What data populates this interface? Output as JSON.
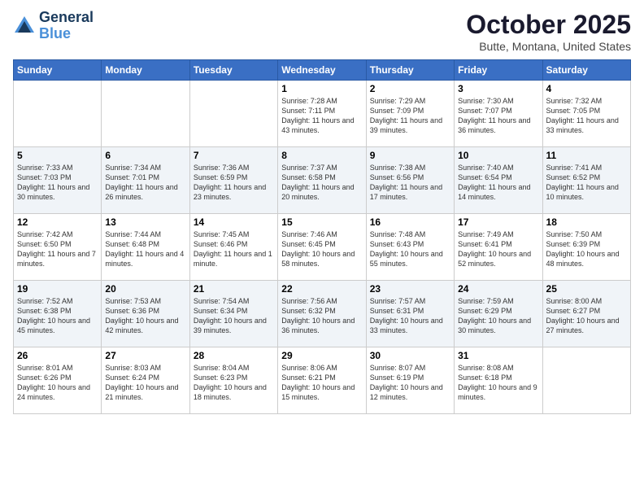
{
  "logo": {
    "line1": "General",
    "line2": "Blue"
  },
  "title": "October 2025",
  "location": "Butte, Montana, United States",
  "weekdays": [
    "Sunday",
    "Monday",
    "Tuesday",
    "Wednesday",
    "Thursday",
    "Friday",
    "Saturday"
  ],
  "weeks": [
    [
      {
        "day": "",
        "sunrise": "",
        "sunset": "",
        "daylight": ""
      },
      {
        "day": "",
        "sunrise": "",
        "sunset": "",
        "daylight": ""
      },
      {
        "day": "",
        "sunrise": "",
        "sunset": "",
        "daylight": ""
      },
      {
        "day": "1",
        "sunrise": "Sunrise: 7:28 AM",
        "sunset": "Sunset: 7:11 PM",
        "daylight": "Daylight: 11 hours and 43 minutes."
      },
      {
        "day": "2",
        "sunrise": "Sunrise: 7:29 AM",
        "sunset": "Sunset: 7:09 PM",
        "daylight": "Daylight: 11 hours and 39 minutes."
      },
      {
        "day": "3",
        "sunrise": "Sunrise: 7:30 AM",
        "sunset": "Sunset: 7:07 PM",
        "daylight": "Daylight: 11 hours and 36 minutes."
      },
      {
        "day": "4",
        "sunrise": "Sunrise: 7:32 AM",
        "sunset": "Sunset: 7:05 PM",
        "daylight": "Daylight: 11 hours and 33 minutes."
      }
    ],
    [
      {
        "day": "5",
        "sunrise": "Sunrise: 7:33 AM",
        "sunset": "Sunset: 7:03 PM",
        "daylight": "Daylight: 11 hours and 30 minutes."
      },
      {
        "day": "6",
        "sunrise": "Sunrise: 7:34 AM",
        "sunset": "Sunset: 7:01 PM",
        "daylight": "Daylight: 11 hours and 26 minutes."
      },
      {
        "day": "7",
        "sunrise": "Sunrise: 7:36 AM",
        "sunset": "Sunset: 6:59 PM",
        "daylight": "Daylight: 11 hours and 23 minutes."
      },
      {
        "day": "8",
        "sunrise": "Sunrise: 7:37 AM",
        "sunset": "Sunset: 6:58 PM",
        "daylight": "Daylight: 11 hours and 20 minutes."
      },
      {
        "day": "9",
        "sunrise": "Sunrise: 7:38 AM",
        "sunset": "Sunset: 6:56 PM",
        "daylight": "Daylight: 11 hours and 17 minutes."
      },
      {
        "day": "10",
        "sunrise": "Sunrise: 7:40 AM",
        "sunset": "Sunset: 6:54 PM",
        "daylight": "Daylight: 11 hours and 14 minutes."
      },
      {
        "day": "11",
        "sunrise": "Sunrise: 7:41 AM",
        "sunset": "Sunset: 6:52 PM",
        "daylight": "Daylight: 11 hours and 10 minutes."
      }
    ],
    [
      {
        "day": "12",
        "sunrise": "Sunrise: 7:42 AM",
        "sunset": "Sunset: 6:50 PM",
        "daylight": "Daylight: 11 hours and 7 minutes."
      },
      {
        "day": "13",
        "sunrise": "Sunrise: 7:44 AM",
        "sunset": "Sunset: 6:48 PM",
        "daylight": "Daylight: 11 hours and 4 minutes."
      },
      {
        "day": "14",
        "sunrise": "Sunrise: 7:45 AM",
        "sunset": "Sunset: 6:46 PM",
        "daylight": "Daylight: 11 hours and 1 minute."
      },
      {
        "day": "15",
        "sunrise": "Sunrise: 7:46 AM",
        "sunset": "Sunset: 6:45 PM",
        "daylight": "Daylight: 10 hours and 58 minutes."
      },
      {
        "day": "16",
        "sunrise": "Sunrise: 7:48 AM",
        "sunset": "Sunset: 6:43 PM",
        "daylight": "Daylight: 10 hours and 55 minutes."
      },
      {
        "day": "17",
        "sunrise": "Sunrise: 7:49 AM",
        "sunset": "Sunset: 6:41 PM",
        "daylight": "Daylight: 10 hours and 52 minutes."
      },
      {
        "day": "18",
        "sunrise": "Sunrise: 7:50 AM",
        "sunset": "Sunset: 6:39 PM",
        "daylight": "Daylight: 10 hours and 48 minutes."
      }
    ],
    [
      {
        "day": "19",
        "sunrise": "Sunrise: 7:52 AM",
        "sunset": "Sunset: 6:38 PM",
        "daylight": "Daylight: 10 hours and 45 minutes."
      },
      {
        "day": "20",
        "sunrise": "Sunrise: 7:53 AM",
        "sunset": "Sunset: 6:36 PM",
        "daylight": "Daylight: 10 hours and 42 minutes."
      },
      {
        "day": "21",
        "sunrise": "Sunrise: 7:54 AM",
        "sunset": "Sunset: 6:34 PM",
        "daylight": "Daylight: 10 hours and 39 minutes."
      },
      {
        "day": "22",
        "sunrise": "Sunrise: 7:56 AM",
        "sunset": "Sunset: 6:32 PM",
        "daylight": "Daylight: 10 hours and 36 minutes."
      },
      {
        "day": "23",
        "sunrise": "Sunrise: 7:57 AM",
        "sunset": "Sunset: 6:31 PM",
        "daylight": "Daylight: 10 hours and 33 minutes."
      },
      {
        "day": "24",
        "sunrise": "Sunrise: 7:59 AM",
        "sunset": "Sunset: 6:29 PM",
        "daylight": "Daylight: 10 hours and 30 minutes."
      },
      {
        "day": "25",
        "sunrise": "Sunrise: 8:00 AM",
        "sunset": "Sunset: 6:27 PM",
        "daylight": "Daylight: 10 hours and 27 minutes."
      }
    ],
    [
      {
        "day": "26",
        "sunrise": "Sunrise: 8:01 AM",
        "sunset": "Sunset: 6:26 PM",
        "daylight": "Daylight: 10 hours and 24 minutes."
      },
      {
        "day": "27",
        "sunrise": "Sunrise: 8:03 AM",
        "sunset": "Sunset: 6:24 PM",
        "daylight": "Daylight: 10 hours and 21 minutes."
      },
      {
        "day": "28",
        "sunrise": "Sunrise: 8:04 AM",
        "sunset": "Sunset: 6:23 PM",
        "daylight": "Daylight: 10 hours and 18 minutes."
      },
      {
        "day": "29",
        "sunrise": "Sunrise: 8:06 AM",
        "sunset": "Sunset: 6:21 PM",
        "daylight": "Daylight: 10 hours and 15 minutes."
      },
      {
        "day": "30",
        "sunrise": "Sunrise: 8:07 AM",
        "sunset": "Sunset: 6:19 PM",
        "daylight": "Daylight: 10 hours and 12 minutes."
      },
      {
        "day": "31",
        "sunrise": "Sunrise: 8:08 AM",
        "sunset": "Sunset: 6:18 PM",
        "daylight": "Daylight: 10 hours and 9 minutes."
      },
      {
        "day": "",
        "sunrise": "",
        "sunset": "",
        "daylight": ""
      }
    ]
  ]
}
